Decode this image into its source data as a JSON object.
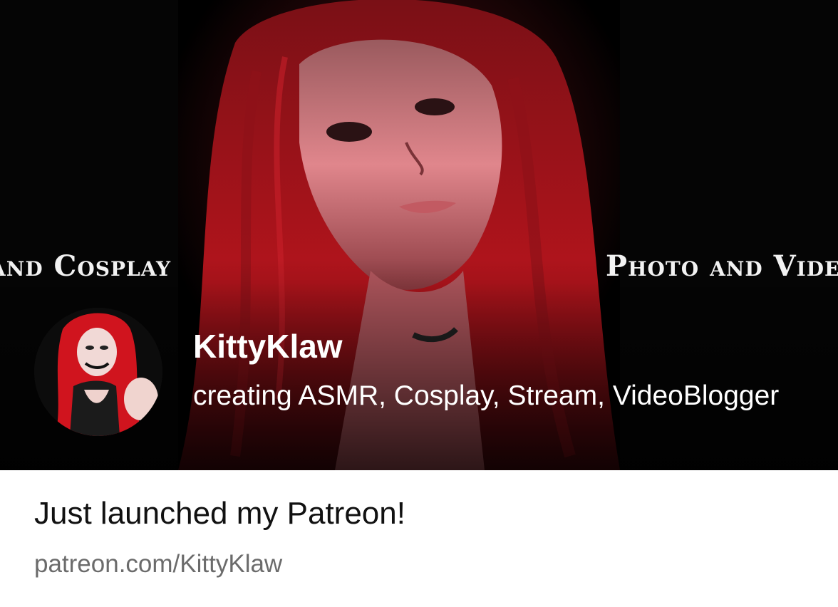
{
  "banner": {
    "left_text": "and Cosplay",
    "right_text": "Photo and Video"
  },
  "creator": {
    "name": "KittyKlaw",
    "tagline": "creating ASMR, Cosplay, Stream, VideoBlogger"
  },
  "post": {
    "title": "Just launched my Patreon!",
    "link": "patreon.com/KittyKlaw"
  },
  "colors": {
    "banner_bg": "#000000",
    "hair_red": "#b3141c",
    "title_text": "#111111",
    "link_text": "#6b6b6b"
  }
}
